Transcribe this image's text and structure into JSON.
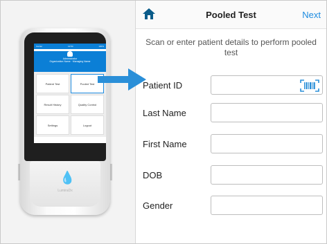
{
  "device": {
    "status_left": "Carrier",
    "status_center": "12:54",
    "status_right": "100%",
    "user_name": "Administrator",
    "user_org": "Organization Name · Managing Name",
    "menu": [
      "Patient Test",
      "Pooled Test",
      "Result History",
      "Quality Control",
      "Settings",
      "Logout"
    ],
    "brand": "LumiraDx"
  },
  "navbar": {
    "title": "Pooled Test",
    "next_label": "Next",
    "home_icon": "home-icon"
  },
  "instructions": "Scan or enter patient details to perform pooled test",
  "form": {
    "fields": [
      {
        "label": "Patient ID",
        "value": "",
        "has_barcode": true
      },
      {
        "label": "Last Name",
        "value": ""
      },
      {
        "label": "First Name",
        "value": ""
      },
      {
        "label": "DOB",
        "value": ""
      },
      {
        "label": "Gender",
        "value": ""
      }
    ]
  },
  "colors": {
    "accent": "#1c8be0",
    "home_icon": "#0b5c8a"
  }
}
